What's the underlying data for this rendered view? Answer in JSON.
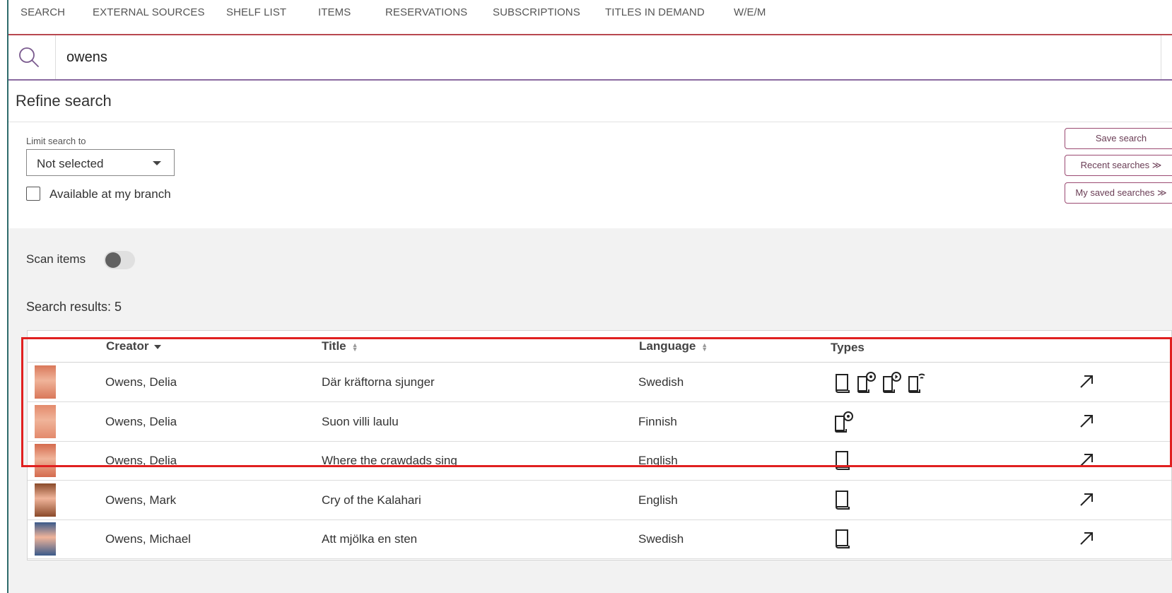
{
  "nav": {
    "tabs": [
      {
        "label": "SEARCH"
      },
      {
        "label": "EXTERNAL SOURCES"
      },
      {
        "label": "SHELF LIST"
      },
      {
        "label": "ITEMS"
      },
      {
        "label": "RESERVATIONS"
      },
      {
        "label": "SUBSCRIPTIONS"
      },
      {
        "label": "TITLES IN DEMAND"
      },
      {
        "label": "W/E/M"
      }
    ]
  },
  "search": {
    "value": "owens",
    "icon": "search-icon"
  },
  "refine": {
    "title": "Refine search",
    "limit_label": "Limit search to",
    "limit_value": "Not selected",
    "checkbox_label": "Available at my branch",
    "checkbox_checked": false,
    "buttons": {
      "save": "Save search",
      "recent": "Recent searches ≫",
      "saved": "My saved searches ≫"
    }
  },
  "scan": {
    "label": "Scan items",
    "enabled": false
  },
  "results": {
    "count_label": "Search results: 5",
    "columns": {
      "creator": "Creator",
      "title": "Title",
      "language": "Language",
      "types": "Types"
    },
    "rows": [
      {
        "creator": "Owens, Delia",
        "title": "Där kräftorna sjunger",
        "language": "Swedish",
        "types": [
          "book-icon",
          "audiobook-disc-icon",
          "audiobook-play-icon",
          "ebook-icon"
        ],
        "cover_color": "#d9785a"
      },
      {
        "creator": "Owens, Delia",
        "title": "Suon villi laulu",
        "language": "Finnish",
        "types": [
          "audiobook-disc-icon"
        ],
        "cover_color": "#e38a6c"
      },
      {
        "creator": "Owens, Delia",
        "title": "Where the crawdads sing",
        "language": "English",
        "types": [
          "book-icon"
        ],
        "cover_color": "#d46b4e"
      },
      {
        "creator": "Owens, Mark",
        "title": "Cry of the Kalahari",
        "language": "English",
        "types": [
          "book-icon"
        ],
        "cover_color": "#8a4a2a"
      },
      {
        "creator": "Owens, Michael",
        "title": "Att mjölka en sten",
        "language": "Swedish",
        "types": [
          "book-icon"
        ],
        "cover_color": "#3a5a8a"
      }
    ]
  },
  "colors": {
    "nav_underline": "#b8484f",
    "search_underline": "#8a6aa0",
    "button_border": "#9b4a72",
    "highlight": "#e02020"
  }
}
